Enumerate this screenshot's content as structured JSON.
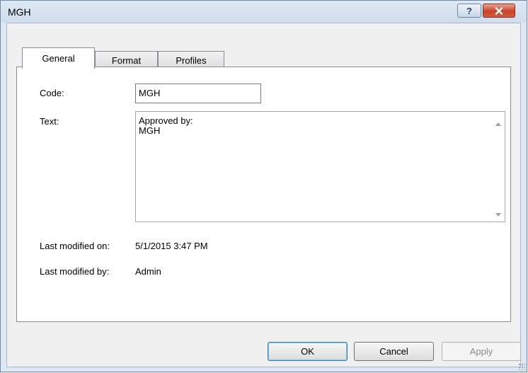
{
  "window": {
    "title": "MGH"
  },
  "titlebar": {
    "help_glyph": "?",
    "close_glyph": "✕"
  },
  "tabs": [
    {
      "label": "General",
      "active": true
    },
    {
      "label": "Format",
      "active": false
    },
    {
      "label": "Profiles",
      "active": false
    }
  ],
  "form": {
    "code_label": "Code:",
    "code_value": "MGH",
    "text_label": "Text:",
    "text_value": "Approved by:\nMGH",
    "modified_on_label": "Last modified on:",
    "modified_on_value": "5/1/2015 3:47 PM",
    "modified_by_label": "Last modified by:",
    "modified_by_value": "Admin"
  },
  "buttons": {
    "ok": "OK",
    "cancel": "Cancel",
    "apply": "Apply"
  },
  "icons": {
    "help": "help-icon",
    "close": "close-icon",
    "scroll_up": "scroll-up-arrow-icon",
    "scroll_down": "scroll-down-arrow-icon",
    "resize": "resize-grip-icon"
  },
  "colors": {
    "close_button": "#c7432a",
    "default_button_border": "#3c7fb1",
    "title_bar": "#dfe9f5"
  }
}
